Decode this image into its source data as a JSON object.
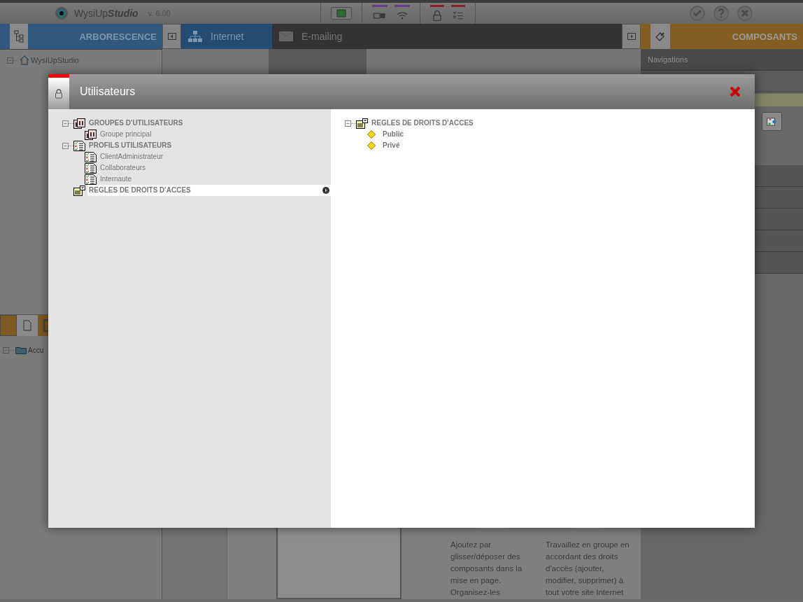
{
  "app": {
    "name": "WysiUp",
    "name_emphasis": "Studio",
    "version": "v. 6.00"
  },
  "left_panel": {
    "title": "ARBORESCENCE",
    "tree": [
      {
        "label": "WysiUpStudio",
        "expanded": true
      }
    ]
  },
  "center_tabs": [
    {
      "label": "Internet",
      "selected": true
    },
    {
      "label": "E-mailing",
      "selected": false
    }
  ],
  "right_panel": {
    "title": "COMPOSANTS",
    "section": "Navigations"
  },
  "lower_left_panel": {
    "tree": [
      {
        "label": "Accu",
        "expanded": true
      }
    ]
  },
  "content": {
    "columns": [
      {
        "text": "Ajoutez par glisser/déposer des composants dans la mise en page. Organisez-les"
      },
      {
        "text": "Travaillez en groupe en accordant des droits d'accès (ajouter, modifier, supprimer) à tout votre site Internet"
      }
    ]
  },
  "dialog": {
    "title": "Utilisateurs",
    "tree": [
      {
        "label": "GROUPES D'UTILISATEURS",
        "kind": "group",
        "expanded": true,
        "selected": false,
        "children": [
          {
            "label": "Groupe principal",
            "kind": "group",
            "selected": false
          }
        ]
      },
      {
        "label": "PROFILS UTILISATEURS",
        "kind": "profile",
        "expanded": true,
        "selected": false,
        "children": [
          {
            "label": "ClientAdministrateur",
            "kind": "profile",
            "selected": false
          },
          {
            "label": "Collaborateurs",
            "kind": "profile",
            "selected": false
          },
          {
            "label": "Internaute",
            "kind": "profile",
            "selected": false
          }
        ]
      },
      {
        "label": "REGLES DE DROITS D'ACCES",
        "kind": "rules",
        "selected": true
      }
    ],
    "detail_tree": [
      {
        "label": "REGLES DE DROITS D'ACCES",
        "kind": "rules",
        "expanded": true,
        "children": [
          {
            "label": "Public",
            "kind": "rule"
          },
          {
            "label": "Privé",
            "kind": "rule"
          }
        ]
      }
    ]
  }
}
